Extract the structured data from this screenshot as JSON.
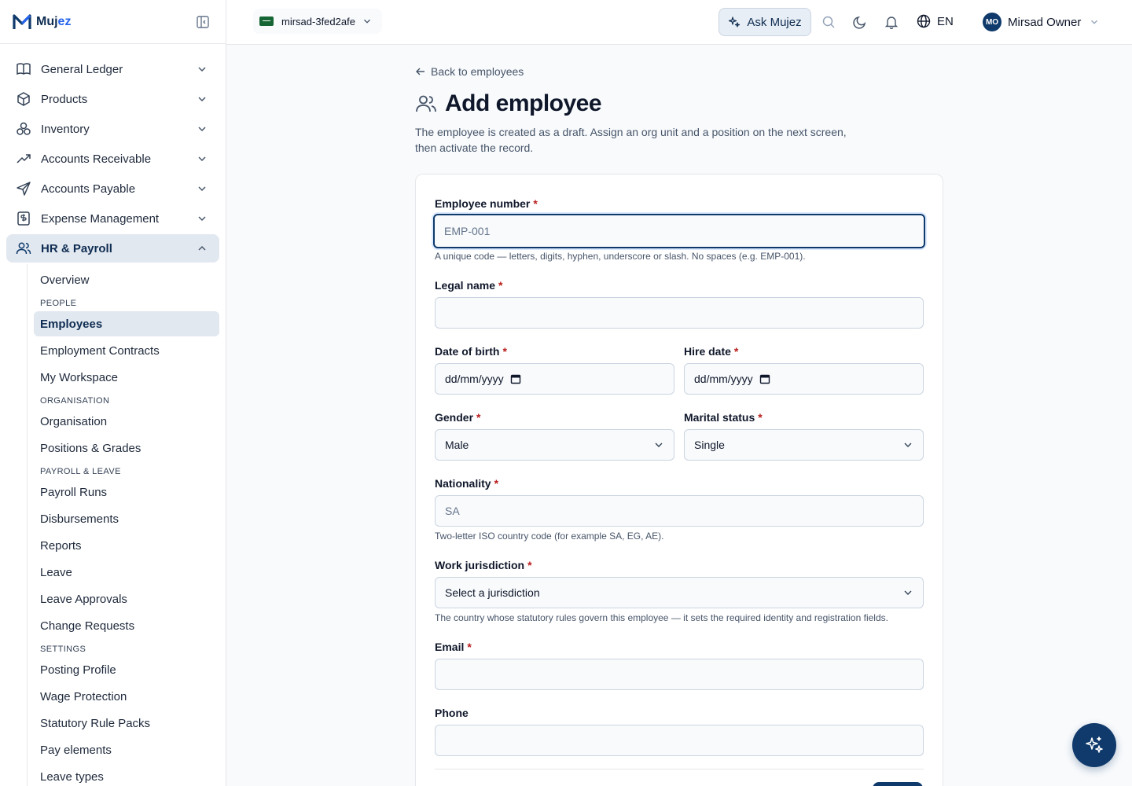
{
  "brand": {
    "name_main": "Muj",
    "name_accent": "ez"
  },
  "sidebar": {
    "modules": [
      {
        "label": "General Ledger",
        "icon": "book-icon"
      },
      {
        "label": "Products",
        "icon": "box-icon"
      },
      {
        "label": "Inventory",
        "icon": "boxes-icon"
      },
      {
        "label": "Accounts Receivable",
        "icon": "trend-up-icon"
      },
      {
        "label": "Accounts Payable",
        "icon": "send-icon"
      },
      {
        "label": "Expense Management",
        "icon": "receipt-icon"
      },
      {
        "label": "HR & Payroll",
        "icon": "users-icon",
        "active": true
      }
    ],
    "hr": {
      "overview": "Overview",
      "people_heading": "PEOPLE",
      "employees": "Employees",
      "employment_contracts": "Employment Contracts",
      "my_workspace": "My Workspace",
      "org_heading": "ORGANISATION",
      "organisation": "Organisation",
      "positions_grades": "Positions & Grades",
      "payroll_heading": "PAYROLL & LEAVE",
      "payroll_runs": "Payroll Runs",
      "disbursements": "Disbursements",
      "reports": "Reports",
      "leave": "Leave",
      "leave_approvals": "Leave Approvals",
      "change_requests": "Change Requests",
      "settings_heading": "SETTINGS",
      "posting_profile": "Posting Profile",
      "wage_protection": "Wage Protection",
      "statutory_rule_packs": "Statutory Rule Packs",
      "pay_elements": "Pay elements",
      "leave_types": "Leave types"
    }
  },
  "topbar": {
    "tenant": "mirsad-3fed2afe",
    "ask": "Ask Mujez",
    "language": "EN",
    "user_initials": "MO",
    "user_name": "Mirsad Owner"
  },
  "page": {
    "back": "Back to employees",
    "title": "Add employee",
    "description": "The employee is created as a draft. Assign an org unit and a position on the next screen, then activate the record."
  },
  "form": {
    "employee_number": {
      "label": "Employee number",
      "placeholder": "EMP-001",
      "help": "A unique code — letters, digits, hyphen, underscore or slash. No spaces (e.g. EMP-001)."
    },
    "legal_name": {
      "label": "Legal name",
      "value": ""
    },
    "date_of_birth": {
      "label": "Date of birth",
      "placeholder": "dd/mm/yyyy"
    },
    "hire_date": {
      "label": "Hire date",
      "placeholder": "dd/mm/yyyy"
    },
    "gender": {
      "label": "Gender",
      "value": "Male"
    },
    "marital_status": {
      "label": "Marital status",
      "value": "Single"
    },
    "nationality": {
      "label": "Nationality",
      "placeholder": "SA",
      "help": "Two-letter ISO country code (for example SA, EG, AE)."
    },
    "work_jurisdiction": {
      "label": "Work jurisdiction",
      "value": "Select a jurisdiction",
      "help": "The country whose statutory rules govern this employee — it sets the required identity and registration fields."
    },
    "email": {
      "label": "Email",
      "value": ""
    },
    "phone": {
      "label": "Phone",
      "value": ""
    },
    "required_marker": "*"
  },
  "colors": {
    "brand": "#0f3a6b",
    "accent": "#2563eb",
    "required": "#b91c1c",
    "active_bg": "#e2e8f0"
  }
}
